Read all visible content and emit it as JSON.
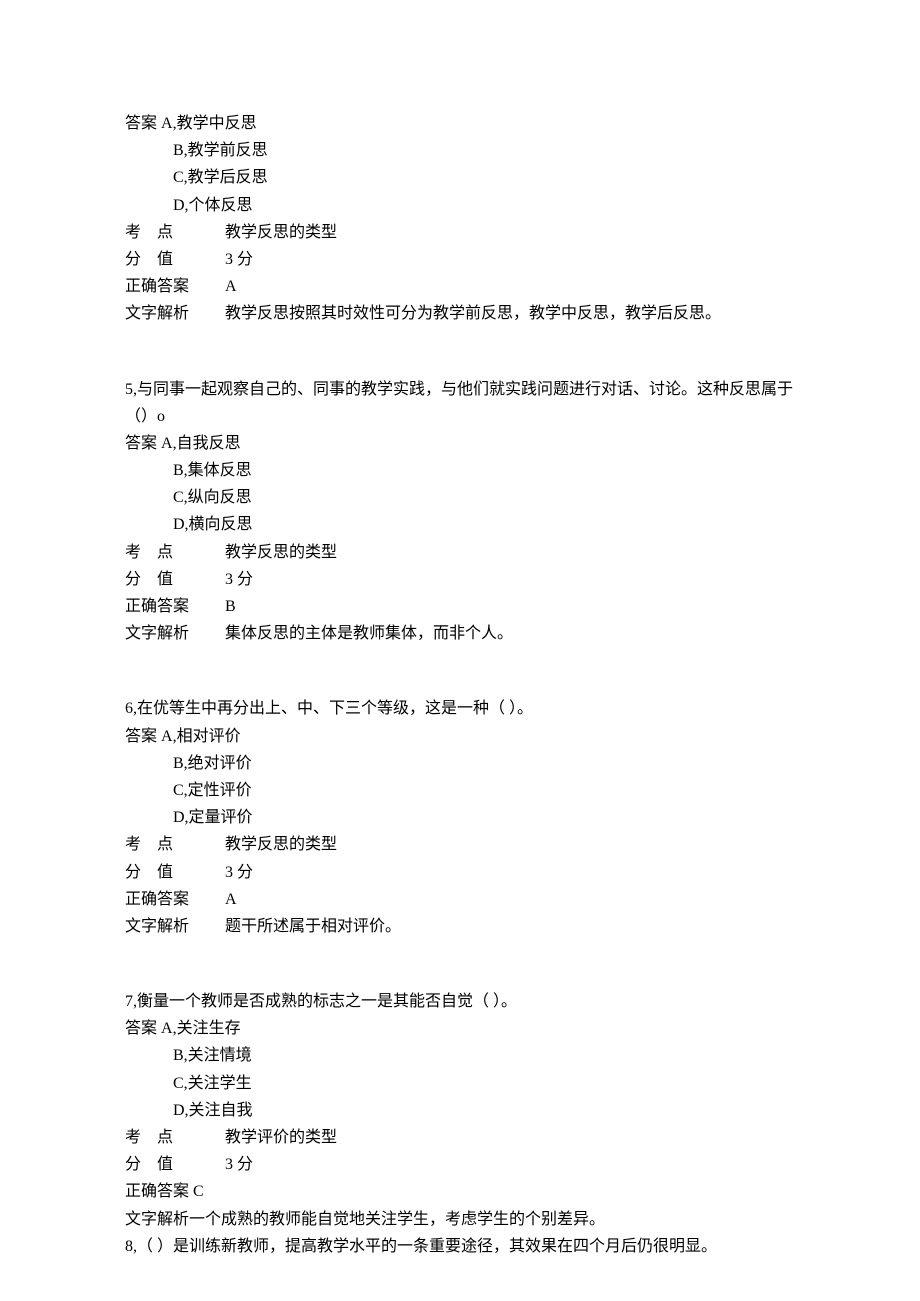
{
  "q4": {
    "ans_prefix": "答案 ",
    "a": "A,教学中反思",
    "b": "B,教学前反思",
    "c": "C,教学后反思",
    "d": "D,个体反思",
    "kp_label": "考    点",
    "kp_value": "教学反思的类型",
    "score_label": "分    值",
    "score_value": "3 分",
    "correct_label": "正确答案",
    "correct_value": "A",
    "explain_label": "文字解析",
    "explain_value": "教学反思按照其时效性可分为教学前反思，教学中反思，教学后反思。"
  },
  "q5": {
    "stem": "5,与同事一起观察自己的、同事的教学实践，与他们就实践问题进行对话、讨论。这种反思属于（）o",
    "ans_prefix": "答案 ",
    "a": "A,自我反思",
    "b": "B,集体反思",
    "c": "C,纵向反思",
    "d": "D,横向反思",
    "kp_label": "考    点",
    "kp_value": "教学反思的类型",
    "score_label": "分    值",
    "score_value": "3 分",
    "correct_label": "正确答案",
    "correct_value": "B",
    "explain_label": "文字解析",
    "explain_value": "集体反思的主体是教师集体，而非个人。"
  },
  "q6": {
    "stem": "6,在优等生中再分出上、中、下三个等级，这是一种（          ）。",
    "ans_prefix": "答案 ",
    "a": "A,相对评价",
    "b": "B,绝对评价",
    "c": "C,定性评价",
    "d": "D,定量评价",
    "kp_label": "考    点",
    "kp_value": "教学反思的类型",
    "score_label": "分    值",
    "score_value": "3 分",
    "correct_label": "正确答案",
    "correct_value": "A",
    "explain_label": "文字解析",
    "explain_value": "题干所述属于相对评价。"
  },
  "q7": {
    "stem": "7,衡量一个教师是否成熟的标志之一是其能否自觉（          ）。",
    "ans_prefix": "答案 ",
    "a": "A,关注生存",
    "b": "B,关注情境",
    "c": "C,关注学生",
    "d": "D,关注自我",
    "kp_label": "考    点",
    "kp_value": "教学评价的类型",
    "score_label": "分    值",
    "score_value": "3 分",
    "correct_label": "正确答案 ",
    "correct_value": "C",
    "explain_label": "文字解析",
    "explain_value": "一个成熟的教师能自觉地关注学生，考虑学生的个别差异。"
  },
  "q8": {
    "stem": "8,（      ）是训练新教师，提高教学水平的一条重要途径，其效果在四个月后仍很明显。"
  }
}
